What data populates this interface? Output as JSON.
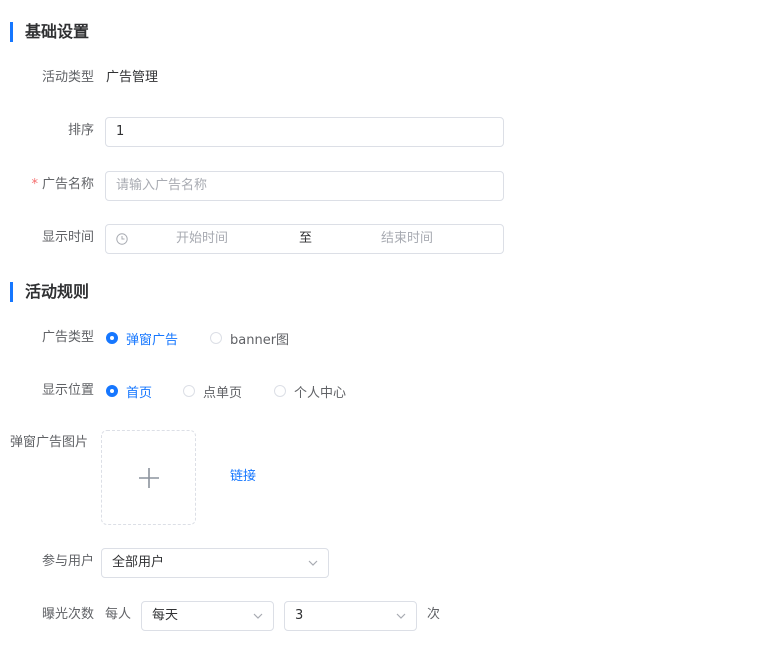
{
  "sections": {
    "basic": "基础设置",
    "rules": "活动规则"
  },
  "basic": {
    "activity_type_label": "活动类型",
    "activity_type_value": "广告管理",
    "sort_label": "排序",
    "sort_value": "1",
    "name_required_mark": "*",
    "name_label": "广告名称",
    "name_placeholder": "请输入广告名称",
    "time_label": "显示时间",
    "time_start_placeholder": "开始时间",
    "time_separator": "至",
    "time_end_placeholder": "结束时间"
  },
  "rules": {
    "ad_type_label": "广告类型",
    "ad_type_options": [
      "弹窗广告",
      "banner图"
    ],
    "ad_type_selected": "弹窗广告",
    "position_label": "显示位置",
    "position_options": [
      "首页",
      "点单页",
      "个人中心"
    ],
    "position_selected": "首页",
    "image_label": "弹窗广告图片",
    "link_label": "链接",
    "users_label": "参与用户",
    "users_value": "全部用户",
    "exposure_label": "曝光次数",
    "exposure_prefix": "每人",
    "exposure_period_value": "每天",
    "exposure_count_value": "3",
    "exposure_suffix": "次"
  },
  "icons": {
    "clock": "clock-icon",
    "plus": "plus-icon",
    "chevron": "chevron-down-icon"
  },
  "colors": {
    "accent": "#1677ff",
    "required": "#f56c6c",
    "border": "#dcdfe6",
    "placeholder": "#a8abb2"
  }
}
